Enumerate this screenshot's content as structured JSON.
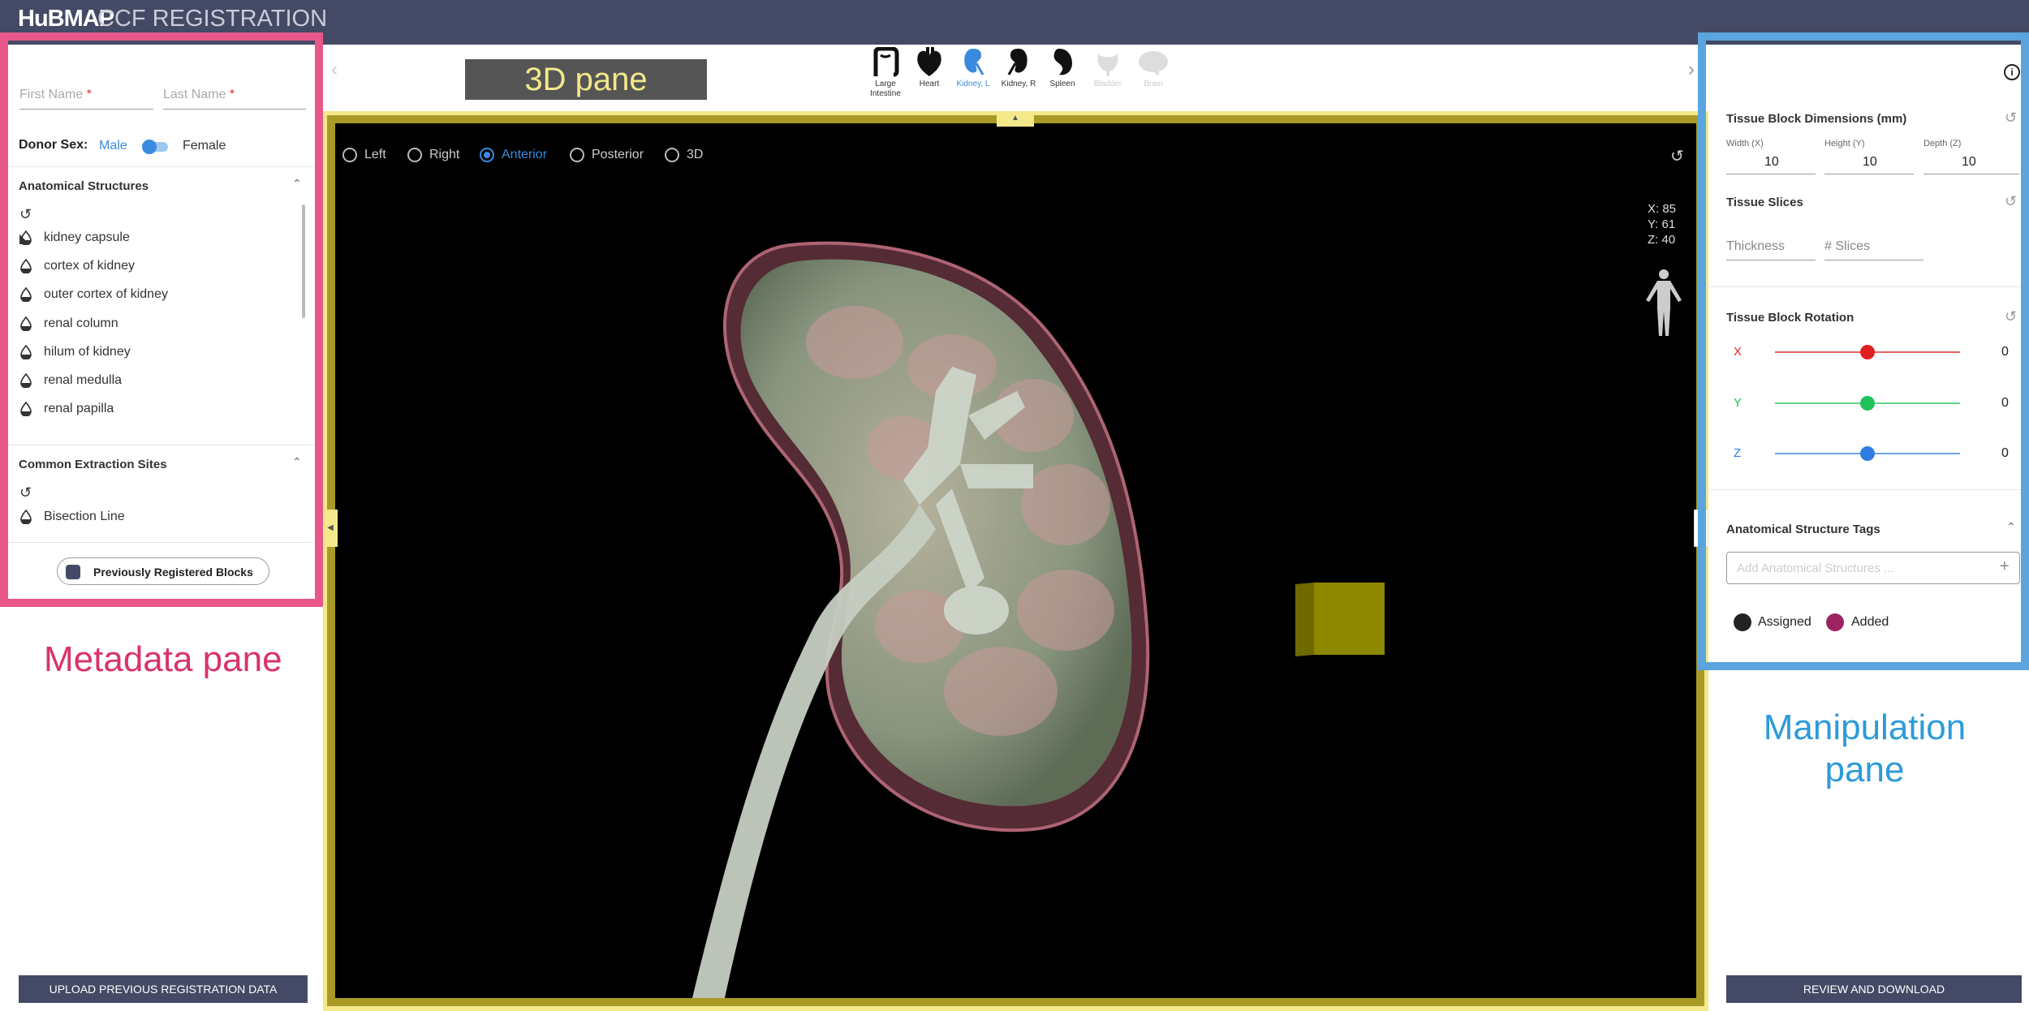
{
  "header": {
    "logo": "HuBMAP",
    "title": "CCF REGISTRATION"
  },
  "metadata": {
    "first_name_placeholder": "First Name",
    "last_name_placeholder": "Last Name",
    "required_mark": "*",
    "donor_sex_label": "Donor Sex:",
    "sex_male": "Male",
    "sex_female": "Female",
    "anatomical_title": "Anatomical Structures",
    "anatomical_items": [
      "kidney capsule",
      "cortex of kidney",
      "outer cortex of kidney",
      "renal column",
      "hilum of kidney",
      "renal medulla",
      "renal papilla"
    ],
    "extraction_title": "Common Extraction Sites",
    "extraction_items": [
      "Bisection Line"
    ],
    "prev_blocks_button": "Previously Registered Blocks",
    "upload_button": "UPLOAD PREVIOUS REGISTRATION DATA"
  },
  "organs": [
    {
      "label1": "Large",
      "label2": "Intestine"
    },
    {
      "label1": "Heart",
      "label2": ""
    },
    {
      "label1": "Kidney, L",
      "label2": ""
    },
    {
      "label1": "Kidney, R",
      "label2": ""
    },
    {
      "label1": "Spleen",
      "label2": ""
    },
    {
      "label1": "Bladder",
      "label2": ""
    },
    {
      "label1": "Brain",
      "label2": ""
    }
  ],
  "viewer": {
    "views": [
      "Left",
      "Right",
      "Anterior",
      "Posterior",
      "3D"
    ],
    "selected_view": "Anterior",
    "coords": {
      "x": "X: 85",
      "y": "Y: 61",
      "z": "Z: 40"
    }
  },
  "manipulation": {
    "dims_title": "Tissue Block Dimensions (mm)",
    "width_label": "Width (X)",
    "height_label": "Height (Y)",
    "depth_label": "Depth (Z)",
    "width_value": "10",
    "height_value": "10",
    "depth_value": "10",
    "slices_title": "Tissue Slices",
    "thickness_placeholder": "Thickness",
    "slices_placeholder": "# Slices",
    "rotation_title": "Tissue Block Rotation",
    "rot_x_label": "X",
    "rot_y_label": "Y",
    "rot_z_label": "Z",
    "rot_x_value": "0",
    "rot_y_value": "0",
    "rot_z_value": "0",
    "tags_title": "Anatomical Structure Tags",
    "tags_placeholder": "Add Anatomical Structures ...",
    "legend_assigned": "Assigned",
    "legend_added": "Added",
    "review_button": "REVIEW AND DOWNLOAD",
    "colors": {
      "x": "#e02020",
      "y": "#1fc25a",
      "z": "#2f7de0",
      "assigned": "#222222",
      "added": "#9c2463"
    }
  },
  "annotations": {
    "pane_3d": "3D pane",
    "pane_meta": "Metadata pane",
    "pane_manip_1": "Manipulation",
    "pane_manip_2": "pane"
  }
}
